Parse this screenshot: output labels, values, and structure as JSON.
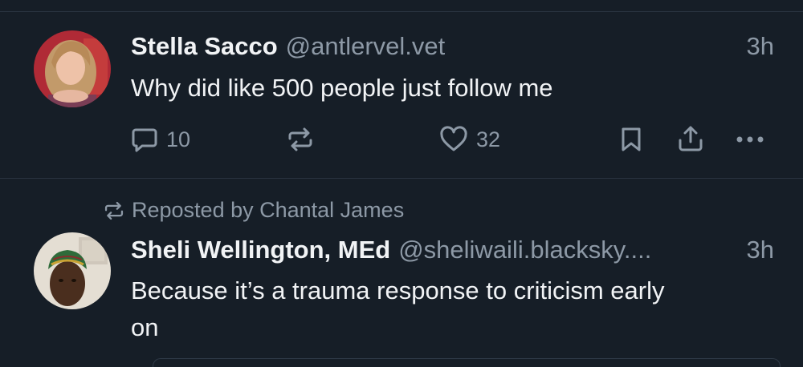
{
  "posts": [
    {
      "author_name": "Stella Sacco",
      "handle": "@antlervel.vet",
      "time": "3h",
      "text": "Why did like 500 people just follow me",
      "reply_count": "10",
      "like_count": "32"
    },
    {
      "reposted_by": "Reposted by Chantal James",
      "author_name": "Sheli Wellington, MEd",
      "handle": "@sheliwaili.blacksky....",
      "time": "3h",
      "text_line1": "Because it’s a trauma response to criticism early",
      "text_line2": "on"
    }
  ],
  "icons": {
    "reply": "speech-bubble-icon",
    "repost": "repost-arrows-icon",
    "like": "heart-icon",
    "bookmark": "bookmark-icon",
    "share": "share-upload-icon",
    "more": "ellipsis-icon"
  },
  "colors": {
    "background": "#161e27",
    "text": "#f1f3f5",
    "muted": "#8d99a6",
    "divider": "#2a3441"
  }
}
